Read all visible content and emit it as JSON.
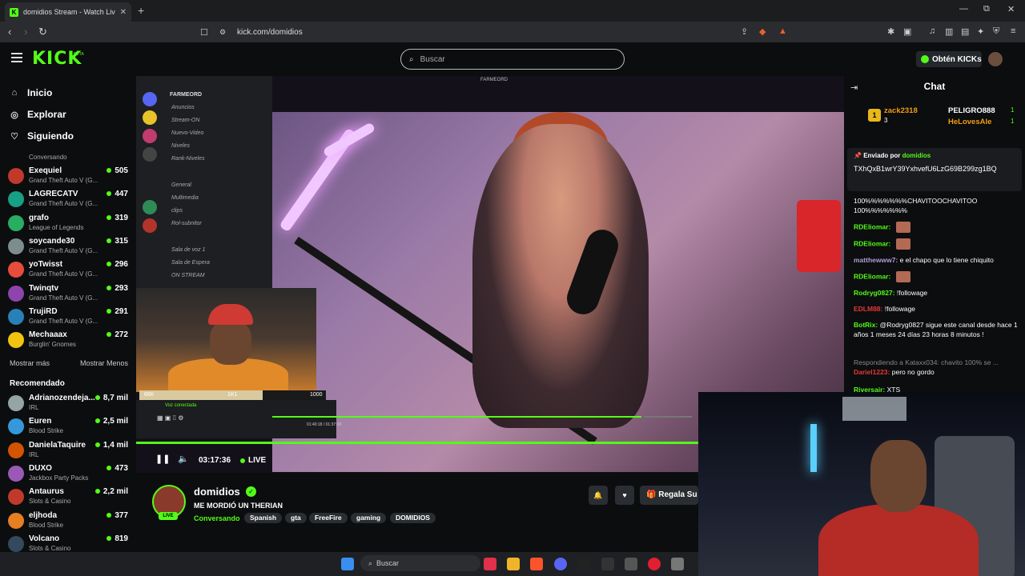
{
  "browser": {
    "tab_title": "domidios Stream - Watch Liv",
    "tab_close": "✕",
    "new_tab": "+",
    "url": "kick.com/domidios",
    "window_min": "—",
    "window_max": "⧉",
    "window_close": "✕"
  },
  "header": {
    "logo": "KICK",
    "logo_beta": "BETA",
    "search_placeholder": "Buscar",
    "kicks_button": "Obtén KICKs"
  },
  "sidebar": {
    "nav": [
      {
        "label": "Inicio",
        "icon": "home-icon",
        "glyph": "⌂"
      },
      {
        "label": "Explorar",
        "icon": "compass-icon",
        "glyph": "◎"
      },
      {
        "label": "Siguiendo",
        "icon": "heart-icon",
        "glyph": "♡"
      }
    ],
    "top_partial_category": "Conversando",
    "following": [
      {
        "name": "Exequiel",
        "category": "Grand Theft Auto V (G...",
        "viewers": "505",
        "color": "#c0392b"
      },
      {
        "name": "LAGRECATV",
        "category": "Grand Theft Auto V (G...",
        "viewers": "447",
        "color": "#16a085"
      },
      {
        "name": "grafo",
        "category": "League of Legends",
        "viewers": "319",
        "color": "#27ae60"
      },
      {
        "name": "soycande30",
        "category": "Grand Theft Auto V (G...",
        "viewers": "315",
        "color": "#7f8c8d"
      },
      {
        "name": "yoTwisst",
        "category": "Grand Theft Auto V (G...",
        "viewers": "296",
        "color": "#e74c3c"
      },
      {
        "name": "Twinqtv",
        "category": "Grand Theft Auto V (G...",
        "viewers": "293",
        "color": "#8e44ad"
      },
      {
        "name": "TrujiRD",
        "category": "Grand Theft Auto V (G...",
        "viewers": "291",
        "color": "#2980b9"
      },
      {
        "name": "Mechaaax",
        "category": "Burglin' Gnomes",
        "viewers": "272",
        "color": "#f1c40f"
      }
    ],
    "show_more": "Mostrar más",
    "show_less": "Mostrar Menos",
    "recommended_header": "Recomendado",
    "recommended": [
      {
        "name": "Adrianozendeja...",
        "category": "IRL",
        "viewers": "8,7 mil",
        "color": "#95a5a6"
      },
      {
        "name": "Euren",
        "category": "Blood Strike",
        "viewers": "2,5 mil",
        "color": "#3498db"
      },
      {
        "name": "DanielaTaquire",
        "category": "IRL",
        "viewers": "1,4 mil",
        "color": "#d35400"
      },
      {
        "name": "DUXO",
        "category": "Jackbox Party Packs",
        "viewers": "473",
        "color": "#9b59b6"
      },
      {
        "name": "Antaurus",
        "category": "Slots & Casino",
        "viewers": "2,2 mil",
        "color": "#c0392b"
      },
      {
        "name": "eljhoda",
        "category": "Blood Strike",
        "viewers": "377",
        "color": "#e67e22"
      },
      {
        "name": "Volcano",
        "category": "Slots & Casino",
        "viewers": "819",
        "color": "#34495e"
      }
    ]
  },
  "stream_overlay": {
    "window_title": "FARMEORD",
    "server_name": "FARMEORD",
    "channels": [
      {
        "label": "Anuncios"
      },
      {
        "label": "Stream-ON"
      },
      {
        "label": "Nuevo-Video"
      },
      {
        "label": "Niveles"
      },
      {
        "label": "Rank-Niveles"
      },
      {
        "label": "General"
      },
      {
        "label": "Multimedia"
      },
      {
        "label": "clips"
      },
      {
        "label": "Rol-subnitor"
      },
      {
        "label": "Sala de voz 1"
      },
      {
        "label": "Sala de Espera"
      },
      {
        "label": "ON STREAM"
      }
    ],
    "bar_left": "66K",
    "bar_mid": "1K1",
    "bar_right": "1000",
    "voice_status": "Voz conectada",
    "inner_time": "01:40:18 / 01:37:08",
    "inner_progress_fraction": 0.88
  },
  "player": {
    "elapsed": "03:17:36",
    "live_label": "LIVE",
    "progress_fraction": 1.0
  },
  "streamer": {
    "name": "domidios",
    "live_pill": "LIVE",
    "title": "ME MORDIÓ UN THERIAN",
    "category": "Conversando",
    "tags": [
      "Spanish",
      "gta",
      "FreeFire",
      "gaming",
      "DOMIDIOS"
    ],
    "gift_button": "Regala Su"
  },
  "chat": {
    "title": "Chat",
    "top_gifters": [
      {
        "rank": "1",
        "name": "zack2318",
        "count": "3",
        "color": "#f39c12"
      },
      {
        "name": "PELIGRO888",
        "count": "1",
        "color": "#ffffff"
      },
      {
        "name": "HeLovesAle",
        "count": "1",
        "color": "#f39c12"
      }
    ],
    "pinned": {
      "sent_by_label": "Enviado por",
      "sent_by_user": "domidios",
      "message": "TXhQxB1wrY39YxhvefU6LzG69B299zg1BQ"
    },
    "messages": [
      {
        "user": "",
        "text": "100%%%%%%%CHAVITOOCHAVITOO 100%%%%%%%",
        "color": "#ffffff"
      },
      {
        "user": "RDEliomar:",
        "text": "",
        "color": "#53fc18",
        "emote": true
      },
      {
        "user": "RDEliomar:",
        "text": "",
        "color": "#53fc18",
        "emote": true
      },
      {
        "user": "matthewww7:",
        "text": "e el chapo que lo tiene chiquito",
        "color": "#b39ddb"
      },
      {
        "user": "RDEliomar:",
        "text": "",
        "color": "#53fc18",
        "emote": true
      },
      {
        "user": "Rodryg0827:",
        "text": "!followage",
        "color": "#53fc18"
      },
      {
        "user": "EDLM88:",
        "text": "!followage",
        "color": "#e53935"
      },
      {
        "user": "BotRix:",
        "text": "@Rodryg0827 sigue este canal desde hace 1 años 1 meses 24 días 23 horas 8 minutos !",
        "color": "#53fc18"
      },
      {
        "user": "",
        "text": "Respondiendo a Kataxx034: chavito 100% se ...",
        "color": "#888888"
      },
      {
        "user": "Dariel1223:",
        "text": "pero no gordo",
        "color": "#e53935"
      },
      {
        "user": "Riversair:",
        "text": "XTS",
        "color": "#53fc18"
      }
    ]
  },
  "taskbar": {
    "search_label": "Buscar"
  },
  "colors": {
    "accent": "#53fc18",
    "background": "#0b0d0e"
  }
}
